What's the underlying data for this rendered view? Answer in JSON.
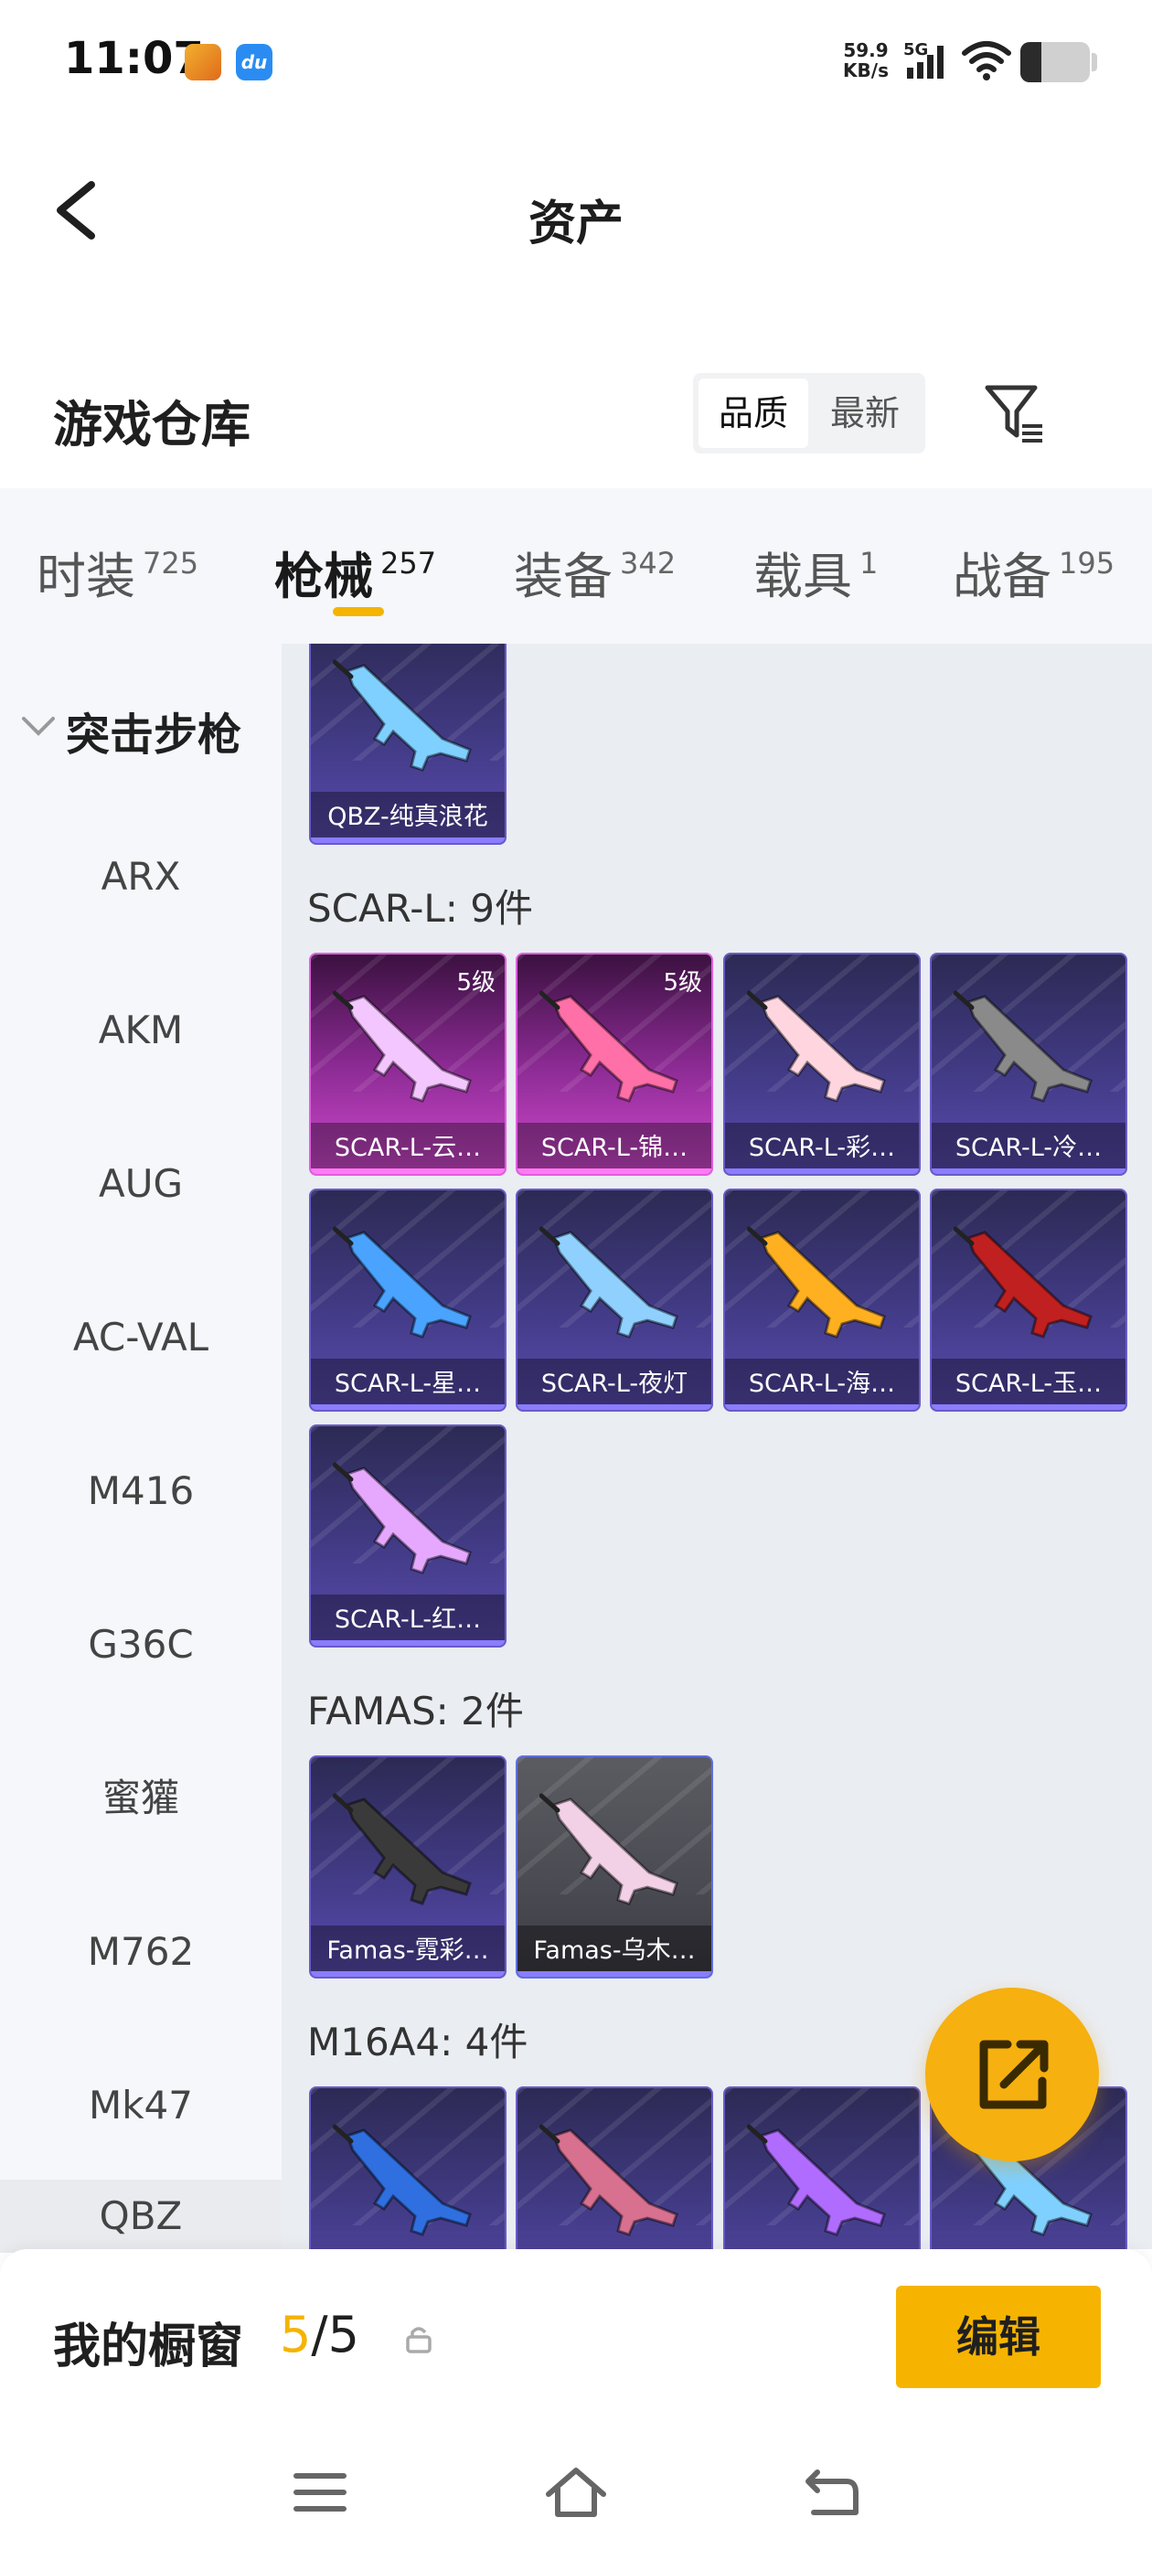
{
  "status_bar": {
    "time": "11:07",
    "app2_label": "du",
    "speed_value": "59.9",
    "speed_unit": "KB/s",
    "network": "5G",
    "battery_level_pct": 30
  },
  "header": {
    "title": "资产"
  },
  "section": {
    "title": "游戏仓库",
    "sort_options": [
      "品质",
      "最新"
    ],
    "sort_selected": "品质"
  },
  "tabs": [
    {
      "label": "时装",
      "count": "725"
    },
    {
      "label": "枪械",
      "count": "257",
      "active": true
    },
    {
      "label": "装备",
      "count": "342"
    },
    {
      "label": "载具",
      "count": "1"
    },
    {
      "label": "战备",
      "count": "195"
    }
  ],
  "sidebar": {
    "group": "突击步枪",
    "items": [
      "ARX",
      "AKM",
      "AUG",
      "AC-VAL",
      "M416",
      "G36C",
      "蜜獾",
      "M762",
      "Mk47",
      "QBZ"
    ]
  },
  "groups": [
    {
      "title": "",
      "items": [
        {
          "name": "QBZ-纯真浪花",
          "tier": "purple",
          "level": ""
        }
      ]
    },
    {
      "title": "SCAR-L: 9件",
      "items": [
        {
          "name": "SCAR-L-云…",
          "tier": "pink",
          "level": "5级"
        },
        {
          "name": "SCAR-L-锦…",
          "tier": "pink",
          "level": "5级"
        },
        {
          "name": "SCAR-L-彩…",
          "tier": "purple",
          "level": ""
        },
        {
          "name": "SCAR-L-冷…",
          "tier": "purple",
          "level": ""
        },
        {
          "name": "SCAR-L-星…",
          "tier": "purple",
          "level": ""
        },
        {
          "name": "SCAR-L-夜灯",
          "tier": "purple",
          "level": ""
        },
        {
          "name": "SCAR-L-海…",
          "tier": "purple",
          "level": ""
        },
        {
          "name": "SCAR-L-玉…",
          "tier": "purple",
          "level": ""
        },
        {
          "name": "SCAR-L-红…",
          "tier": "purple",
          "level": ""
        }
      ]
    },
    {
      "title": "FAMAS: 2件",
      "items": [
        {
          "name": "Famas-霓彩…",
          "tier": "purple",
          "level": ""
        },
        {
          "name": "Famas-乌木…",
          "tier": "grey",
          "level": ""
        }
      ]
    },
    {
      "title": "M16A4: 4件",
      "items": [
        {
          "name": "",
          "tier": "purple",
          "level": ""
        },
        {
          "name": "",
          "tier": "purple",
          "level": ""
        },
        {
          "name": "",
          "tier": "purple",
          "level": ""
        },
        {
          "name": "",
          "tier": "purple",
          "level": ""
        }
      ]
    }
  ],
  "showcase": {
    "label": "我的橱窗",
    "current": "5",
    "separator": "/",
    "total": "5",
    "edit_label": "编辑"
  },
  "colors": {
    "accent": "#f6b400",
    "tab_bg": "#f5f7fb",
    "content_bg": "#eaedf2"
  }
}
